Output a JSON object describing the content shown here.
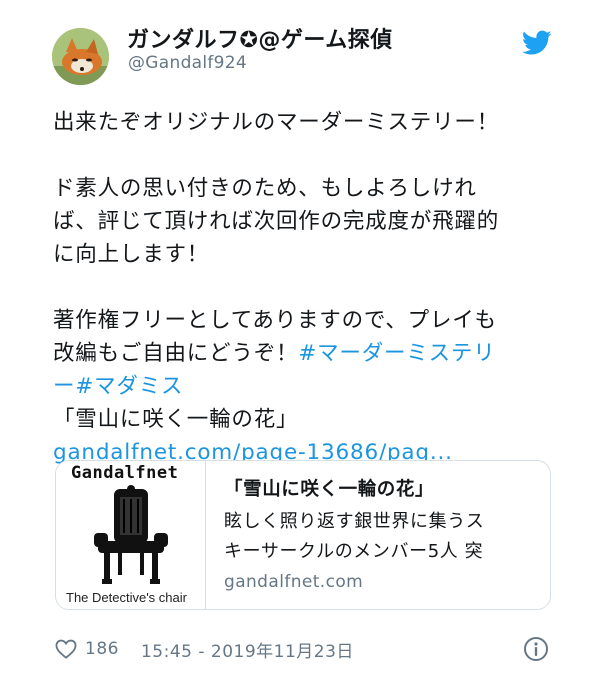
{
  "author": {
    "display_name": "ガンダルフ✪@ゲーム探偵",
    "handle": "@Gandalf924"
  },
  "tweet": {
    "line1": "出来たぞオリジナルのマーダーミステリー！",
    "line2": "ド素人の思い付きのため、もしよろしけれ",
    "line3": "ば、評じて頂ければ次回作の完成度が飛躍的",
    "line4": "に向上します！",
    "line5": "著作権フリーとしてありますので、プレイも",
    "line6_text": "改編もご自由にどうぞ！",
    "hashtag1_part1": "#マーダーミステリ",
    "hashtag1_part2": "ー",
    "hashtag2": "#マダミス",
    "line8": "「雪山に咲く一輪の花」",
    "link": "gandalfnet.com/page-13686/pag..."
  },
  "card": {
    "thumb_title": "Gandalfnet",
    "thumb_caption": "The Detective's chair",
    "title": "「雪山に咲く一輪の花」",
    "desc_line1": "眩しく照り返す銀世界に集うス",
    "desc_line2": "キーサークルのメンバー5人 突",
    "domain": "gandalfnet.com"
  },
  "footer": {
    "likes": "186",
    "timestamp": "15:45 - 2019年11月23日"
  },
  "colors": {
    "link": "#1b95e0",
    "secondary_text": "#657786",
    "border": "#d7dfe5"
  }
}
